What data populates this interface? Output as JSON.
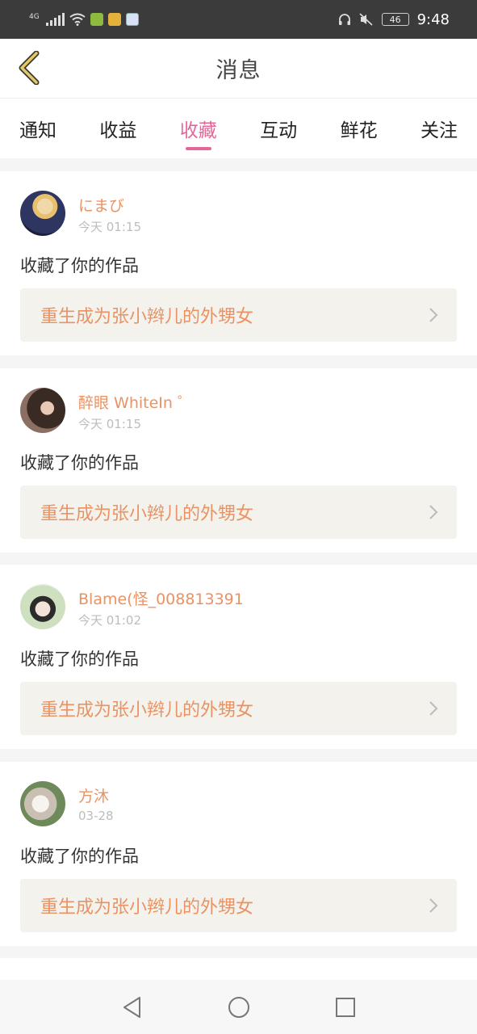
{
  "status_bar": {
    "network_label": "4G",
    "battery": "46",
    "time": "9:48",
    "icons": [
      "signal-icon",
      "wifi-icon",
      "app-notification-icon",
      "app-notification-icon-2",
      "app-notification-icon-3",
      "headphone-icon",
      "mute-icon",
      "battery-icon"
    ]
  },
  "header": {
    "title": "消息",
    "back_icon": "chevron-left-icon"
  },
  "tabs": [
    {
      "label": "通知",
      "active": false
    },
    {
      "label": "收益",
      "active": false
    },
    {
      "label": "收藏",
      "active": true
    },
    {
      "label": "互动",
      "active": false
    },
    {
      "label": "鲜花",
      "active": false
    },
    {
      "label": "关注",
      "active": false
    }
  ],
  "messages": [
    {
      "username": "にまび",
      "time": "今天 01:15",
      "action": "收藏了你的作品",
      "work_title": "重生成为张小辫儿的外甥女"
    },
    {
      "username": "醉眼 WhiteIn ゜",
      "time": "今天 01:15",
      "action": "收藏了你的作品",
      "work_title": "重生成为张小辫儿的外甥女"
    },
    {
      "username": "Blame(怪_008813391",
      "time": "今天 01:02",
      "action": "收藏了你的作品",
      "work_title": "重生成为张小辫儿的外甥女"
    },
    {
      "username": "方沐",
      "time": "03-28",
      "action": "收藏了你的作品",
      "work_title": "重生成为张小辫儿的外甥女"
    }
  ],
  "colors": {
    "accent": "#e4679a",
    "username": "#e99364",
    "link_bg": "#f3f2ec"
  },
  "nav": {
    "icons": [
      "back-triangle-icon",
      "home-circle-icon",
      "recents-square-icon"
    ]
  }
}
